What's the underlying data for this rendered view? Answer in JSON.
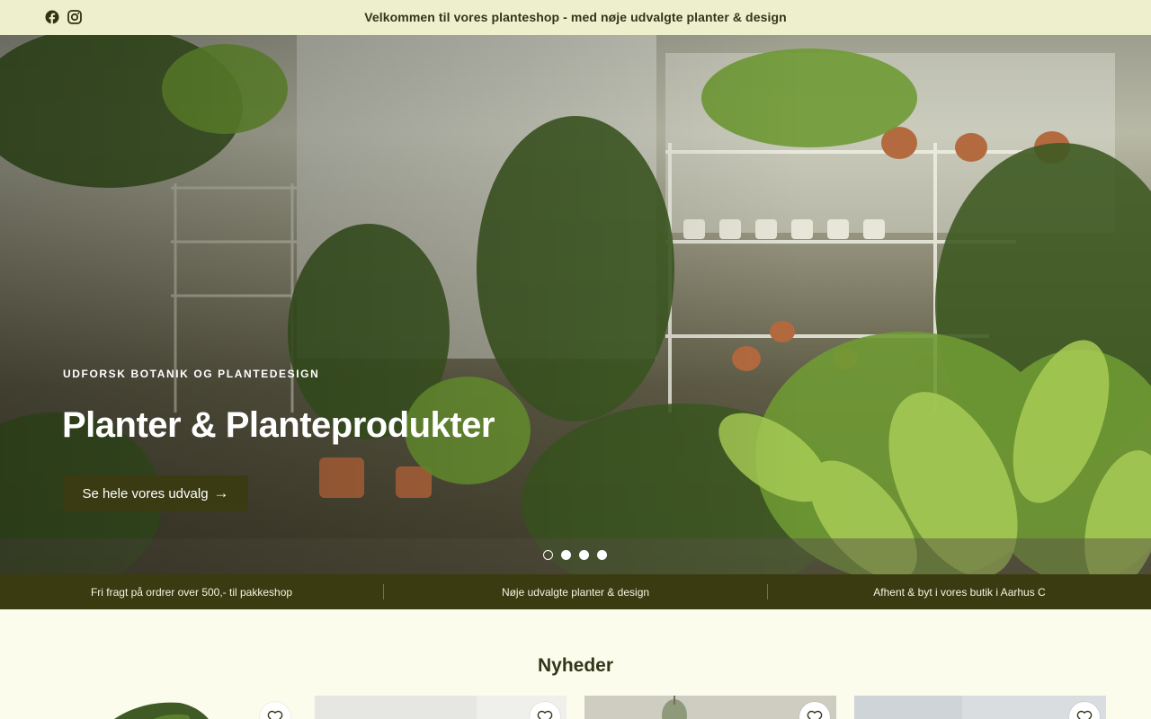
{
  "topbar": {
    "announcement": "Velkommen til vores planteshop - med nøje udvalgte planter & design",
    "social": [
      {
        "icon": "facebook-icon"
      },
      {
        "icon": "instagram-icon"
      }
    ]
  },
  "hero": {
    "eyebrow": "UDFORSK BOTANIK OG PLANTEDESIGN",
    "title": "Planter & Planteprodukter",
    "button_label": "Se hele vores udvalg",
    "button_icon": "arrow-right-icon",
    "slides_total": 4,
    "active_slide": 1
  },
  "usp": {
    "items": [
      "Fri fragt på ordrer over 500,- til pakkeshop",
      "Nøje udvalgte planter & design",
      "Afhent & byt i vores butik i Aarhus C"
    ]
  },
  "news": {
    "title": "Nyheder",
    "wishlist_icon": "heart-icon"
  },
  "colors": {
    "topbar_bg": "#eeefcd",
    "accent_dark": "#3a3b10",
    "page_bg": "#fbfcec",
    "text_dark": "#33351a"
  }
}
